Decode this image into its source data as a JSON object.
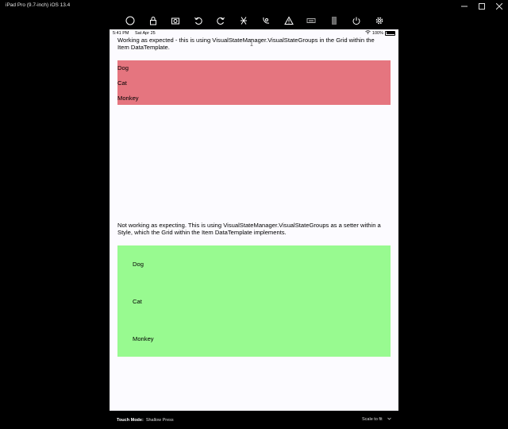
{
  "window": {
    "title": "iPad Pro (9.7-inch) iOS 13.4"
  },
  "toolbar": {
    "icons": [
      "home-icon",
      "lock-icon",
      "screenshot-icon",
      "rotate-left-icon",
      "rotate-right-icon",
      "shake-icon",
      "location-icon",
      "warning-icon",
      "keyboard-icon",
      "device-icon",
      "power-icon",
      "settings-icon"
    ]
  },
  "status_bar": {
    "time": "5:41 PM",
    "date": "Sat Apr 25",
    "battery": "100%"
  },
  "section1": {
    "description": "Working as expected - this is using VisualStateManager.VisualStateGroups in the Grid within the Item DataTemplate.",
    "items": [
      "Dog",
      "Cat",
      "Monkey"
    ],
    "color": "#e5757f"
  },
  "section2": {
    "description": "Not working as expecting. This is using VisualStateManager.VisualStateGroups as a setter within a Style, which the Grid within the Item DataTemplate implements.",
    "items": [
      "Dog",
      "Cat",
      "Monkey"
    ],
    "color": "#98fa90"
  },
  "bottom_bar": {
    "touch_mode_label": "Touch Mode:",
    "touch_mode_value": "Shallow Press",
    "scale_label": "Scale to fit"
  }
}
